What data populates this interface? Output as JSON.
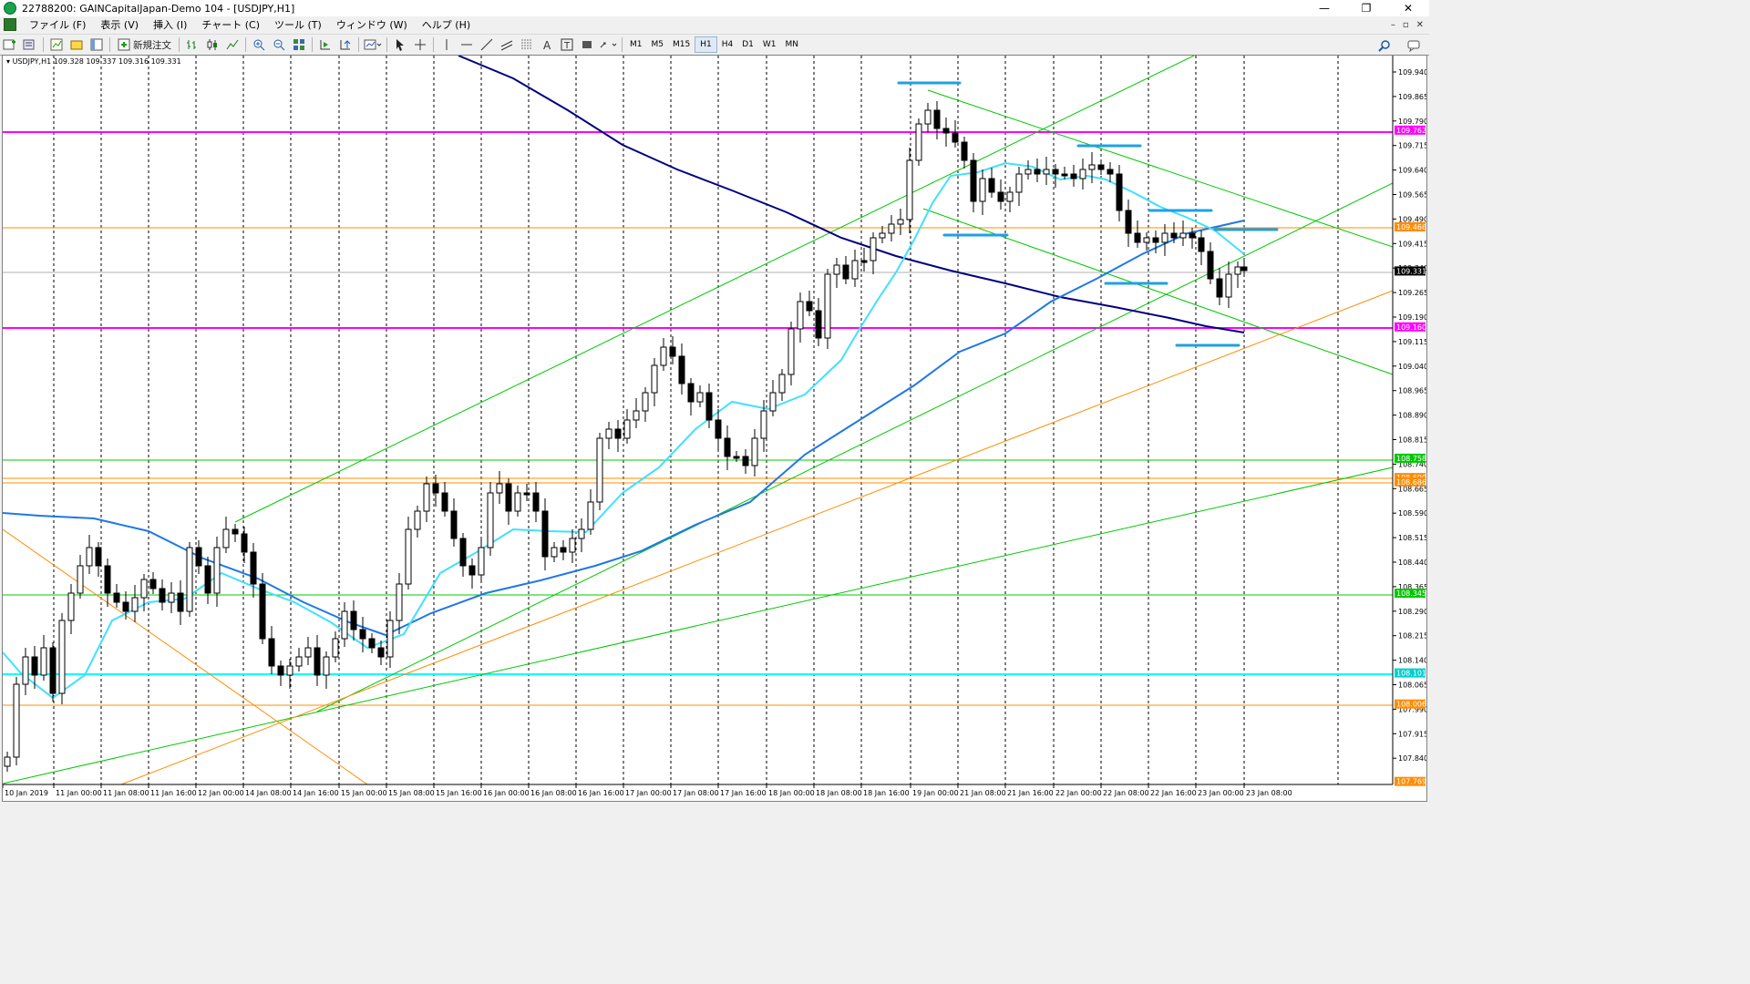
{
  "window": {
    "title": "22788200: GAINCapitalJapan-Demo 104 - [USDJPY,H1]",
    "minimize": "—",
    "restore": "❐",
    "close": "✕"
  },
  "menu": {
    "items": [
      "ファイル (F)",
      "表示 (V)",
      "挿入 (I)",
      "チャート (C)",
      "ツール (T)",
      "ウィンドウ (W)",
      "ヘルプ (H)"
    ],
    "mdi": [
      "–",
      "▫",
      "✕"
    ]
  },
  "toolbar": {
    "new_order_label": "新規注文",
    "timeframes": [
      "M1",
      "M5",
      "M15",
      "H1",
      "H4",
      "D1",
      "W1",
      "MN"
    ],
    "active_timeframe": "H1"
  },
  "chart": {
    "label": "USDJPY,H1  109.328 109.337 109.316 109.331",
    "colors": {
      "magenta": "#ff00ff",
      "orange": "#ff8c00",
      "green": "#00c800",
      "cyan": "#00ffff",
      "sma_fast": "#40e0ff",
      "sma_slow": "#1e78e6",
      "sma_long": "#000080",
      "marker": "#1ea0e6"
    },
    "price_scale": [
      "109.940",
      "109.865",
      "109.790",
      "109.715",
      "109.640",
      "109.565",
      "109.490",
      "109.415",
      "109.340",
      "109.265",
      "109.190",
      "109.115",
      "109.040",
      "108.965",
      "108.890",
      "108.815",
      "108.740",
      "108.665",
      "108.590",
      "108.515",
      "108.440",
      "108.365",
      "108.290",
      "108.215",
      "108.140",
      "108.065",
      "107.990",
      "107.915",
      "107.840"
    ],
    "time_scale": [
      "10 Jan 2019",
      "11 Jan 00:00",
      "11 Jan 08:00",
      "11 Jan 16:00",
      "12 Jan 00:00",
      "14 Jan 08:00",
      "14 Jan 16:00",
      "15 Jan 00:00",
      "15 Jan 08:00",
      "15 Jan 16:00",
      "16 Jan 00:00",
      "16 Jan 08:00",
      "16 Jan 16:00",
      "17 Jan 00:00",
      "17 Jan 08:00",
      "17 Jan 16:00",
      "18 Jan 00:00",
      "18 Jan 08:00",
      "18 Jan 16:00",
      "19 Jan 00:00",
      "21 Jan 08:00",
      "21 Jan 16:00",
      "22 Jan 00:00",
      "22 Jan 08:00",
      "22 Jan 16:00",
      "23 Jan 00:00",
      "23 Jan 08:00"
    ],
    "price_tags": [
      {
        "value": "109.762",
        "color": "#ff00ff"
      },
      {
        "value": "109.466",
        "color": "#ff8c00"
      },
      {
        "value": "109.331",
        "color": "#000000"
      },
      {
        "value": "109.160",
        "color": "#ff00ff"
      },
      {
        "value": "108.758",
        "color": "#00c800"
      },
      {
        "value": "108.699",
        "color": "#ff8c00"
      },
      {
        "value": "108.686",
        "color": "#ff8c00"
      },
      {
        "value": "108.345",
        "color": "#00c800"
      },
      {
        "value": "108.101",
        "color": "#00cfcf"
      },
      {
        "value": "108.006",
        "color": "#ff8c00"
      },
      {
        "value": "107.769",
        "color": "#ff8c00"
      }
    ]
  }
}
